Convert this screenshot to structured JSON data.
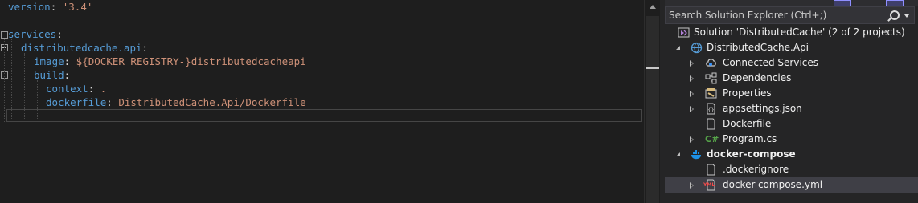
{
  "editor": {
    "lines": [
      {
        "key": "version",
        "sep": ": ",
        "value": "'3.4'"
      },
      {
        "key": "",
        "sep": "",
        "value": ""
      },
      {
        "key": "services",
        "sep": ":",
        "value": ""
      },
      {
        "key": "distributedcache.api",
        "sep": ":",
        "value": ""
      },
      {
        "key": "image",
        "sep": ": ",
        "value": "${DOCKER_REGISTRY-}distributedcacheapi"
      },
      {
        "key": "build",
        "sep": ":",
        "value": ""
      },
      {
        "key": "context",
        "sep": ": ",
        "value": "."
      },
      {
        "key": "dockerfile",
        "sep": ": ",
        "value": "DistributedCache.Api/Dockerfile"
      }
    ]
  },
  "solution_explorer": {
    "search_placeholder": "Search Solution Explorer (Ctrl+;)",
    "items": [
      {
        "label": "Solution 'DistributedCache' (2 of 2 projects)",
        "icon": "solution-icon"
      },
      {
        "label": "DistributedCache.Api",
        "icon": "csharp-project-icon"
      },
      {
        "label": "Connected Services",
        "icon": "connected-services-icon"
      },
      {
        "label": "Dependencies",
        "icon": "dependencies-icon"
      },
      {
        "label": "Properties",
        "icon": "properties-icon"
      },
      {
        "label": "appsettings.json",
        "icon": "json-file-icon"
      },
      {
        "label": "Dockerfile",
        "icon": "file-icon"
      },
      {
        "label": "Program.cs",
        "icon": "csharp-file-icon"
      },
      {
        "label": "docker-compose",
        "icon": "docker-icon"
      },
      {
        "label": ".dockerignore",
        "icon": "file-icon"
      },
      {
        "label": "docker-compose.yml",
        "icon": "yml-file-icon"
      }
    ],
    "csharp_glyph": "C#",
    "yml_glyph": "YML"
  },
  "colors": {
    "yaml_key": "#569cd6",
    "yaml_string": "#ce9178",
    "selection": "#3f3f46",
    "accent": "#8f8fff"
  }
}
